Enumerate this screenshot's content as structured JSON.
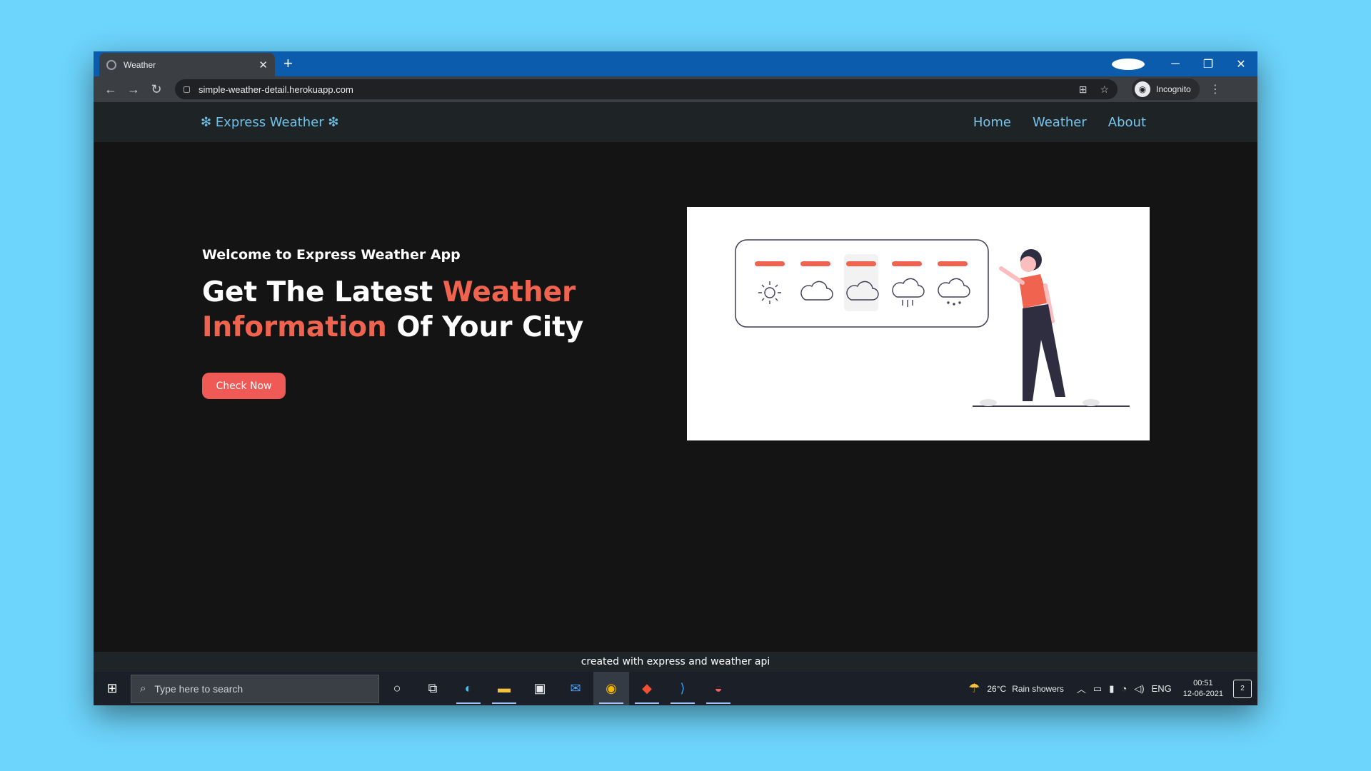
{
  "browser": {
    "tab_title": "Weather",
    "tab_close": "✕",
    "new_tab": "+",
    "url": "simple-weather-detail.herokuapp.com",
    "incognito_label": "Incognito",
    "controls": {
      "minimize": "─",
      "restore": "❐",
      "close": "✕"
    }
  },
  "site": {
    "brand": "❇ Express Weather ❇",
    "nav": {
      "home": "Home",
      "weather": "Weather",
      "about": "About"
    },
    "hero": {
      "welcome": "Welcome to Express Weather App",
      "headline_part1": "Get The Latest ",
      "headline_accent1": "Weather",
      "headline_accent2": "Information",
      "headline_part2": " Of Your City",
      "cta_label": "Check Now"
    },
    "footer": "created with express and weather api"
  },
  "taskbar": {
    "search_placeholder": "Type here to search",
    "weather_temp": "26°C",
    "weather_desc": "Rain showers",
    "lang": "ENG",
    "time": "00:51",
    "date": "12-06-2021",
    "notifications": "2"
  },
  "colors": {
    "accent": "#f0644f",
    "button": "#f05a56",
    "link": "#79c4ec",
    "background": "#141414"
  }
}
